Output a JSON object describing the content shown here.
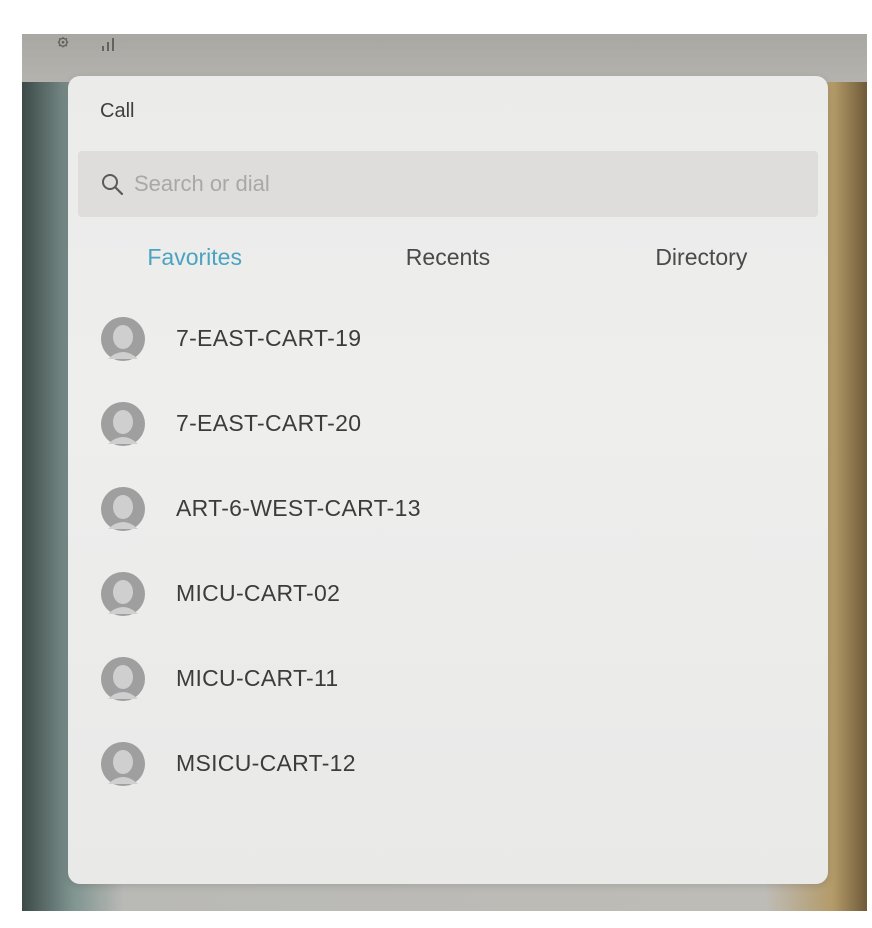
{
  "status_bar": {
    "icons": [
      "gear-icon",
      "signal-bars-icon"
    ]
  },
  "panel": {
    "title": "Call",
    "search": {
      "placeholder": "Search or dial",
      "value": ""
    },
    "tabs": [
      {
        "label": "Favorites",
        "active": true
      },
      {
        "label": "Recents",
        "active": false
      },
      {
        "label": "Directory",
        "active": false
      }
    ],
    "contacts": [
      {
        "name": "7-EAST-CART-19"
      },
      {
        "name": "7-EAST-CART-20"
      },
      {
        "name": "ART-6-WEST-CART-13"
      },
      {
        "name": "MICU-CART-02"
      },
      {
        "name": "MICU-CART-11"
      },
      {
        "name": "MSICU-CART-12"
      }
    ]
  },
  "colors": {
    "accent_tab": "#4aa3c1",
    "panel_background": "#ececeb",
    "avatar_gray": "#9a9a9a"
  }
}
